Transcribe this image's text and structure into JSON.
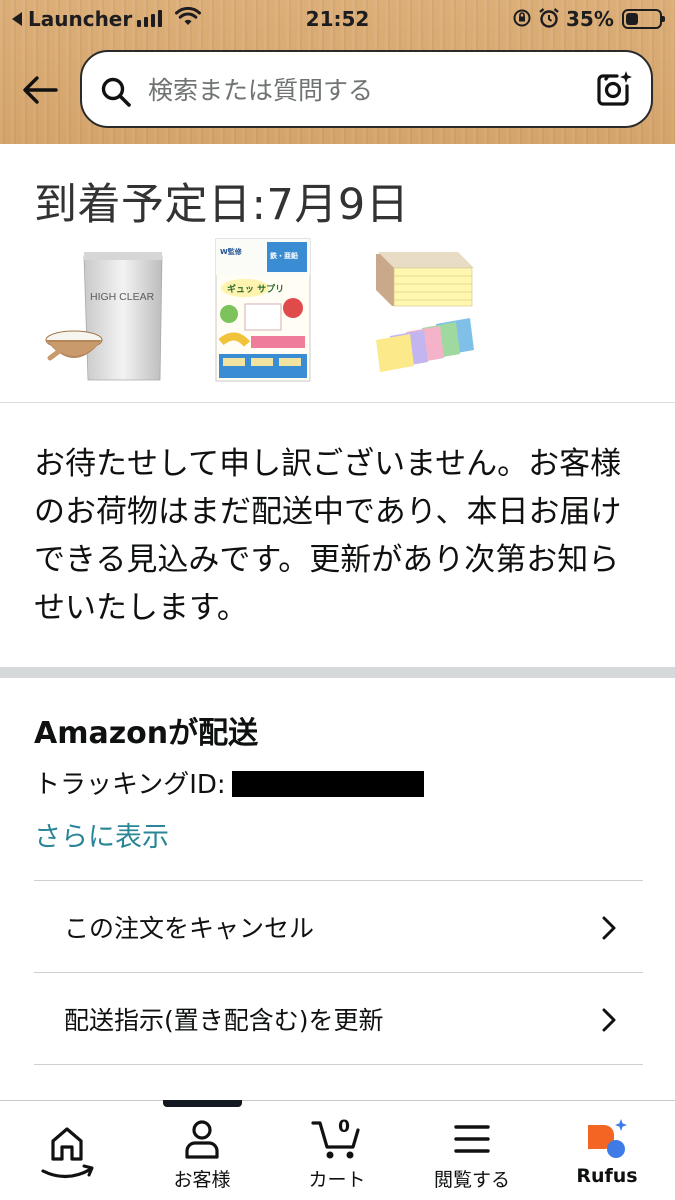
{
  "status_bar": {
    "back_app": "Launcher",
    "time": "21:52",
    "battery_percent": "35%",
    "icons": [
      "signal-icon",
      "wifi-icon",
      "orientation-lock-icon",
      "alarm-icon",
      "battery-icon"
    ]
  },
  "header": {
    "back_icon": "back-arrow-icon",
    "search": {
      "placeholder": "検索または質問する",
      "value": ""
    },
    "camera_icon": "camera-search-icon"
  },
  "arrival": {
    "title": "到着予定日:7月9日",
    "products": [
      {
        "name": "product-thumbnail-protein",
        "text": "HIGH CLEAR"
      },
      {
        "name": "product-thumbnail-supplement",
        "text": "ギュッ サプリ"
      },
      {
        "name": "product-thumbnail-sticky-notes",
        "text": ""
      }
    ]
  },
  "apology": {
    "text": "お待たせして申し訳ございません。お客様のお荷物はまだ配送中であり、本日お届けできる見込みです。更新があり次第お知らせいたします。"
  },
  "shipping": {
    "carrier": "Amazonが配送",
    "tracking_label": "トラッキングID:",
    "more_link": "さらに表示"
  },
  "actions": [
    {
      "label": "この注文をキャンセル"
    },
    {
      "label": "配送指示(置き配含む)を更新"
    }
  ],
  "tabbar": {
    "tabs": [
      {
        "label": "",
        "icon": "home-icon"
      },
      {
        "label": "お客様",
        "icon": "account-icon"
      },
      {
        "label": "カート",
        "icon": "cart-icon",
        "count": "0"
      },
      {
        "label": "閲覧する",
        "icon": "menu-icon"
      },
      {
        "label": "Rufus",
        "icon": "rufus-icon"
      }
    ],
    "accent": "#f26522",
    "rufus_blue": "#3e7be6"
  },
  "colors": {
    "header_bg": "#d9ab73",
    "link": "#2a8697",
    "separator": "#d5d9d9"
  }
}
